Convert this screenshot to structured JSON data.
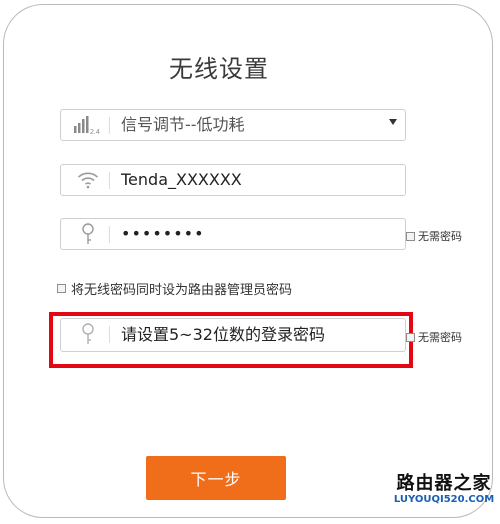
{
  "page": {
    "title": "无线设置"
  },
  "signal": {
    "icon": "signal-2.4-icon",
    "value": "信号调节--低功耗"
  },
  "ssid": {
    "icon": "wifi-icon",
    "value": "Tenda_XXXXXX"
  },
  "wifi_password": {
    "icon": "key-icon",
    "value": "••••••••",
    "no_password_label": "无需密码"
  },
  "sync_admin": {
    "label": "将无线密码同时设为路由器管理员密码"
  },
  "admin_password": {
    "icon": "key-icon",
    "placeholder": "请设置5~32位数的登录密码",
    "no_password_label": "无需密码"
  },
  "actions": {
    "next_label": "下一步"
  },
  "watermark": {
    "main": "路由器之家",
    "sub": "LUYOUQI520.COM"
  },
  "colors": {
    "highlight": "#e30613",
    "button": "#f06d1a"
  }
}
